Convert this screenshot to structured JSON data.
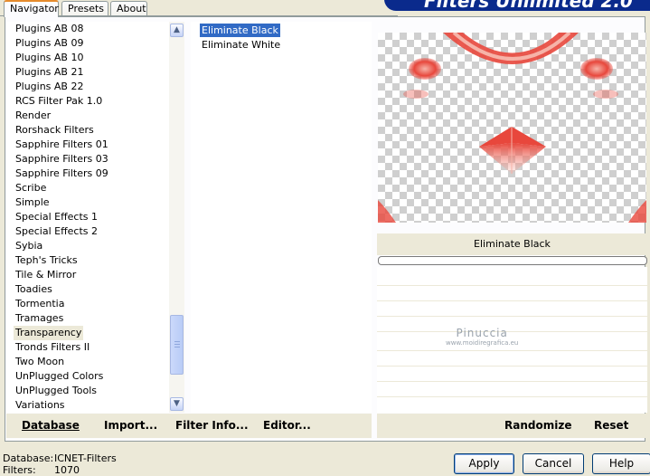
{
  "tabs": [
    {
      "label": "Navigator"
    },
    {
      "label": "Presets"
    },
    {
      "label": "About"
    }
  ],
  "banner": {
    "title": "Filters Unlimited 2.0"
  },
  "categories": [
    "Plugins AB 08",
    "Plugins AB 09",
    "Plugins AB 10",
    "Plugins AB 21",
    "Plugins AB 22",
    "RCS Filter Pak 1.0",
    "Render",
    "Rorshack Filters",
    "Sapphire Filters 01",
    "Sapphire Filters 03",
    "Sapphire Filters 09",
    "Scribe",
    "Simple",
    "Special Effects 1",
    "Special Effects 2",
    "Sybia",
    "Teph's Tricks",
    "Tile & Mirror",
    "Toadies",
    "Tormentia",
    "Tramages",
    "Transparency",
    "Tronds Filters II",
    "Two Moon",
    "UnPlugged Colors",
    "UnPlugged Tools",
    "Variations"
  ],
  "selected_category": "Transparency",
  "filters": [
    "Eliminate Black",
    "Eliminate White"
  ],
  "selected_filter": "Eliminate Black",
  "preview": {
    "filter_name": "Eliminate Black",
    "accent_color": "#e8473c"
  },
  "watermark": {
    "name": "Pinuccia",
    "url": "www.moidiregrafica.eu"
  },
  "left_buttons": {
    "database": "Database",
    "import": "Import...",
    "filter_info": "Filter Info...",
    "editor": "Editor..."
  },
  "right_buttons": {
    "randomize": "Randomize",
    "reset": "Reset"
  },
  "status": {
    "database_label": "Database:",
    "database_value": "ICNET-Filters",
    "filters_label": "Filters:",
    "filters_value": "1070"
  },
  "dialog_buttons": {
    "apply": "Apply",
    "cancel": "Cancel",
    "help": "Help"
  },
  "icons": {
    "scroll_up": "chevron-up-icon",
    "scroll_down": "chevron-down-icon"
  }
}
